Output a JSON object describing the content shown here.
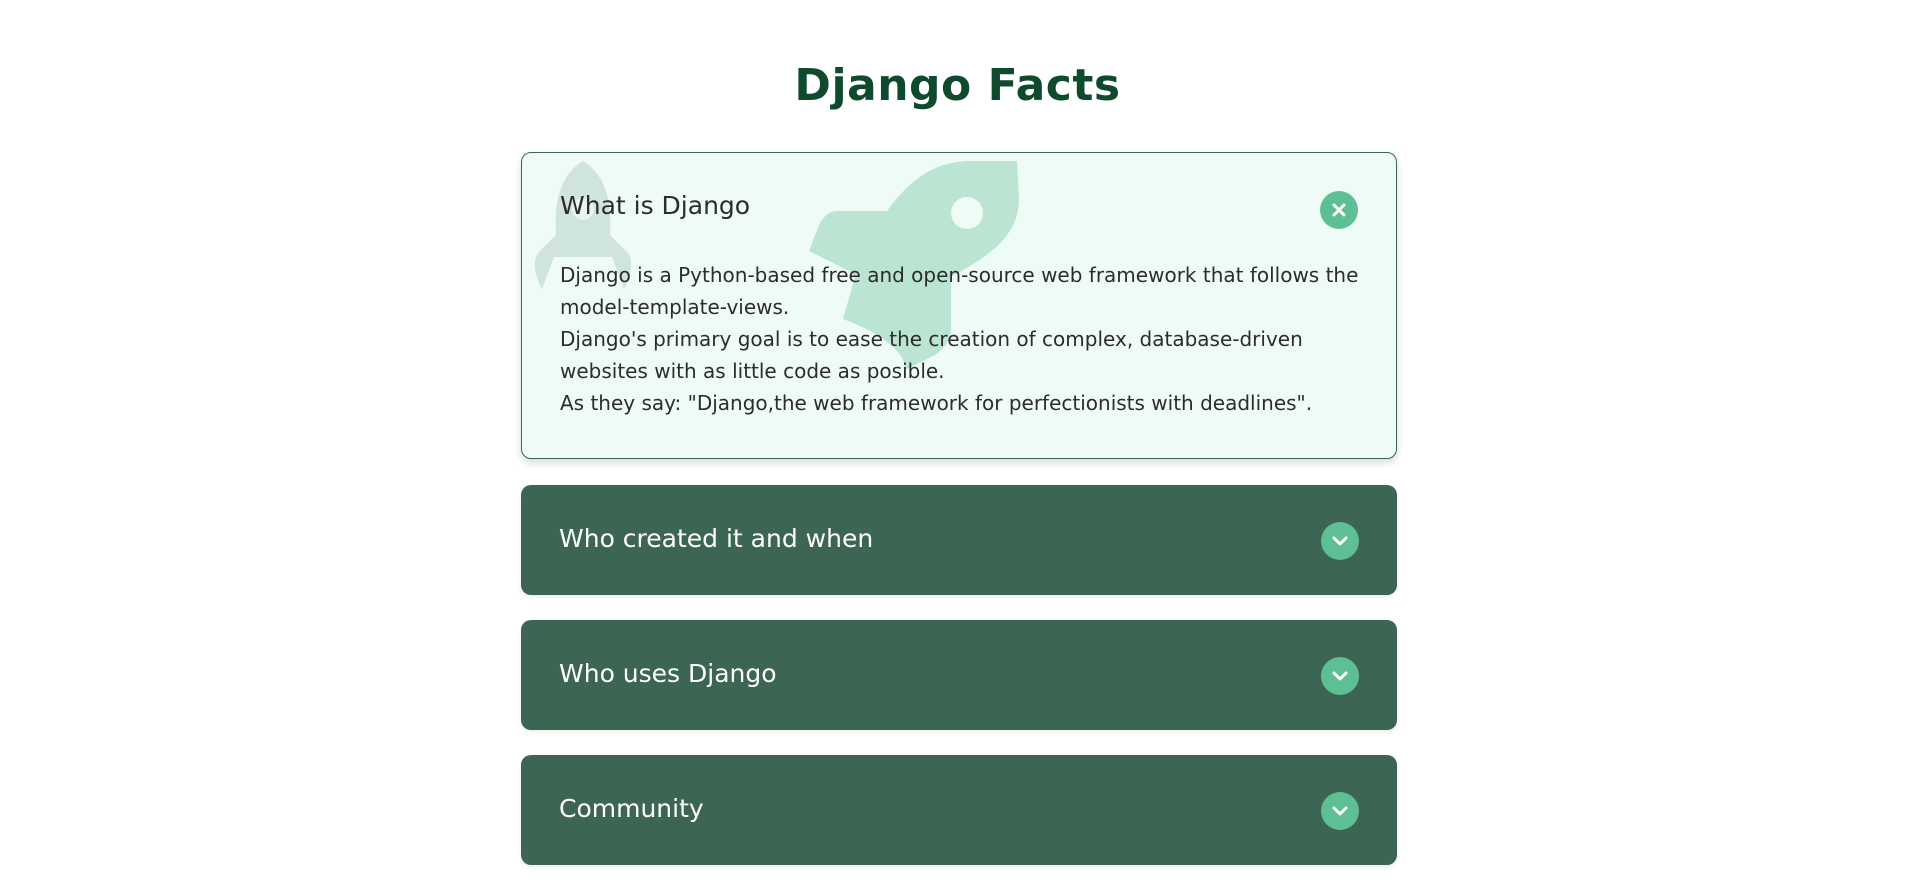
{
  "page": {
    "title": "Django Facts"
  },
  "faqs": [
    {
      "question": "What is Django",
      "expanded": true,
      "answer_lines": [
        "Django is a Python-based free and open-source web framework that follows the model-template-views.",
        "Django's primary goal is to ease the creation of complex, database-driven websites with as little code as posible.",
        "As they say: \"Django,the web framework for perfectionists with deadlines\"."
      ],
      "toggle_icon": "close-icon"
    },
    {
      "question": "Who created it and when",
      "expanded": false,
      "toggle_icon": "chevron-down-icon"
    },
    {
      "question": "Who uses Django",
      "expanded": false,
      "toggle_icon": "chevron-down-icon"
    },
    {
      "question": "Community",
      "expanded": false,
      "toggle_icon": "chevron-down-icon"
    }
  ],
  "colors": {
    "title": "#0e4a2b",
    "closed_card": "#3d6553",
    "open_card_bg": "#effbf6",
    "toggle": "#5dbf93"
  }
}
